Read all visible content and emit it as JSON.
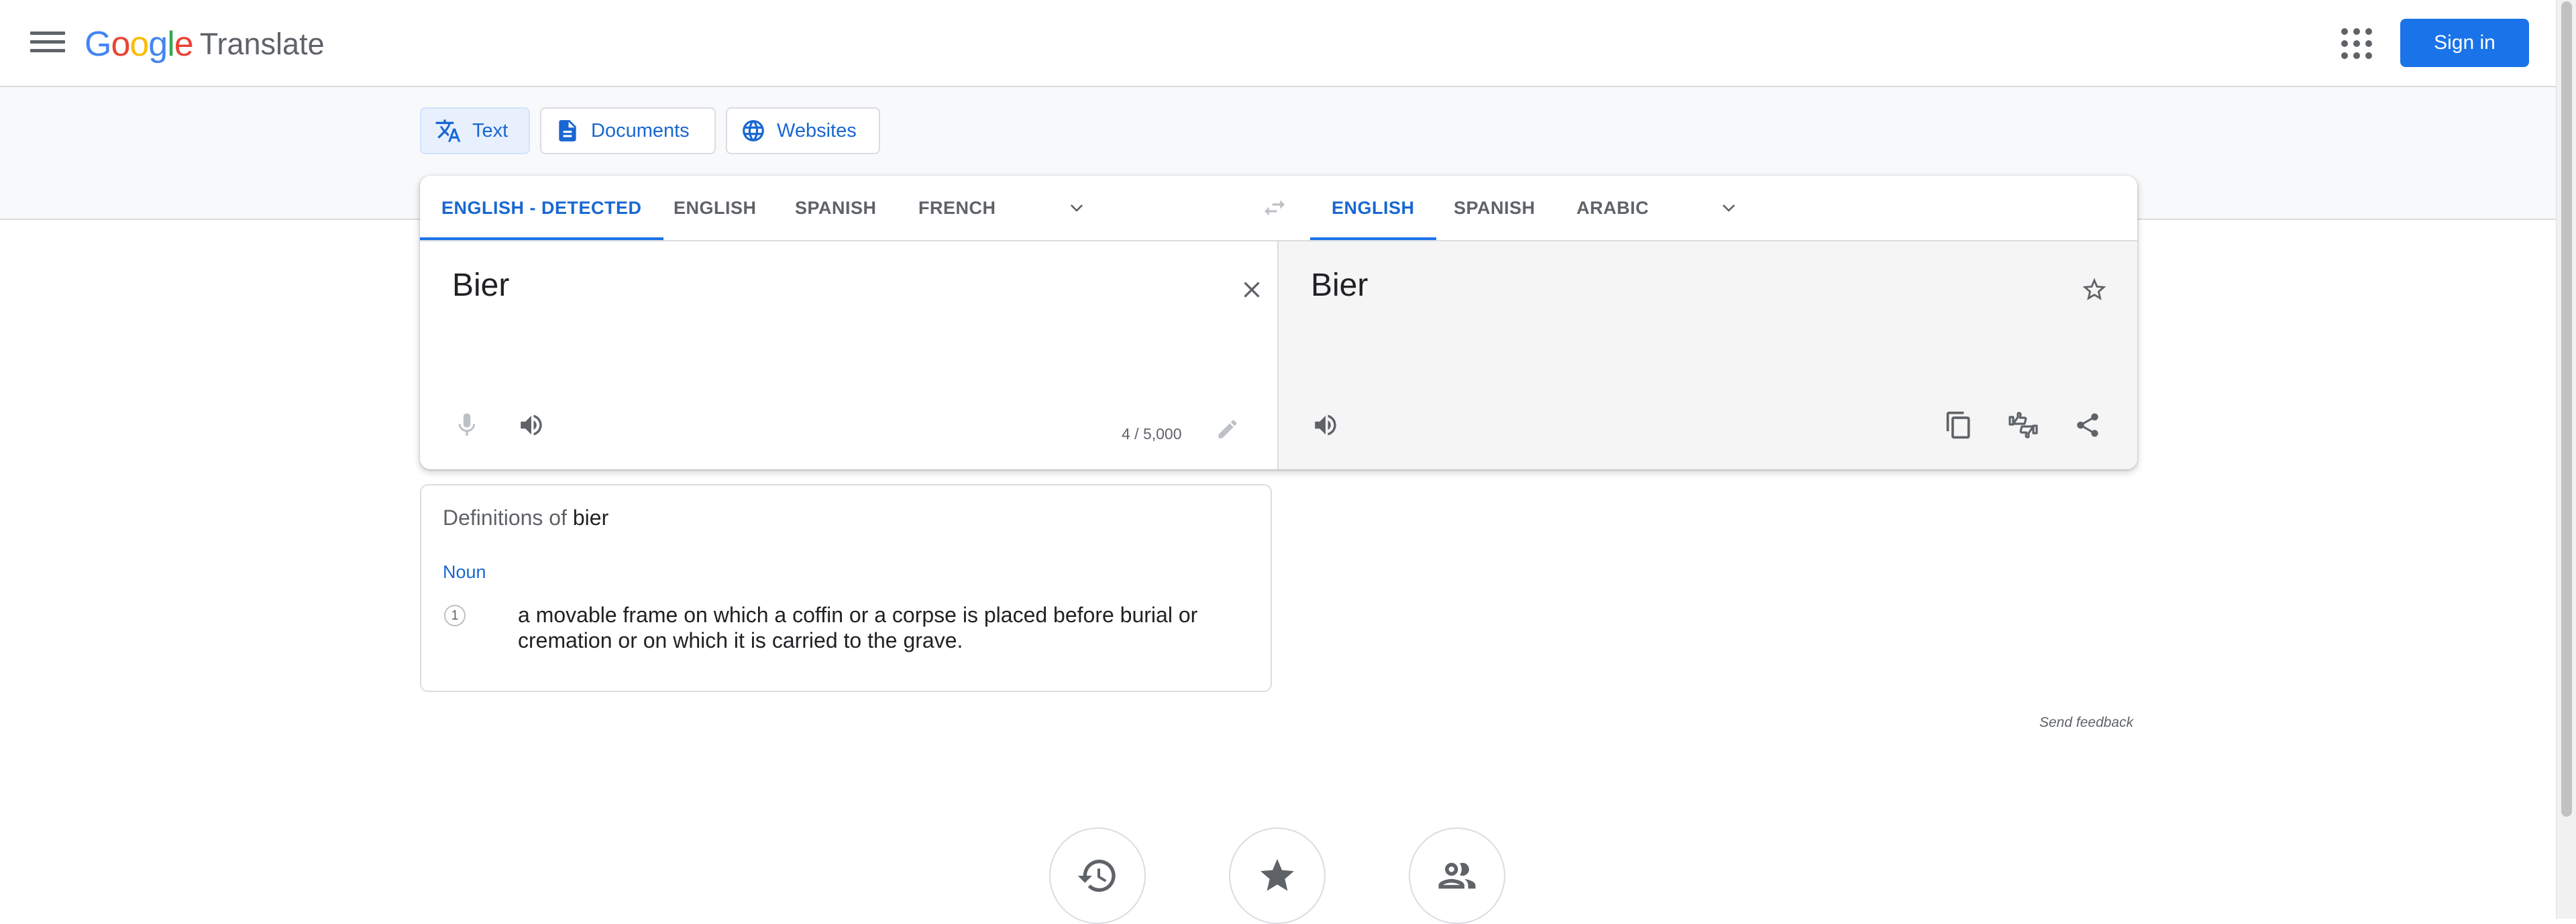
{
  "header": {
    "logo_letters": [
      "G",
      "o",
      "o",
      "g",
      "l",
      "e"
    ],
    "logo_colors": [
      "#4285F4",
      "#EA4335",
      "#FBBC05",
      "#4285F4",
      "#34A853",
      "#EA4335"
    ],
    "product": "Translate",
    "signin_label": "Sign in"
  },
  "modes": [
    {
      "label": "Text",
      "icon": "translate-icon",
      "active": true
    },
    {
      "label": "Documents",
      "icon": "document-icon",
      "active": false
    },
    {
      "label": "Websites",
      "icon": "globe-icon",
      "active": false
    }
  ],
  "source_langs": [
    "ENGLISH - DETECTED",
    "ENGLISH",
    "SPANISH",
    "FRENCH"
  ],
  "target_langs": [
    "ENGLISH",
    "SPANISH",
    "ARABIC"
  ],
  "source": {
    "text": "Bier",
    "counter": "4 / 5,000"
  },
  "target": {
    "text": "Bier"
  },
  "definitions": {
    "title_prefix": "Definitions of",
    "word": "bier",
    "part_of_speech": "Noun",
    "items": [
      {
        "number": "1",
        "text": "a movable frame on which a coffin or a corpse is placed before burial or cremation or on which it is carried to the grave."
      }
    ]
  },
  "feedback_label": "Send feedback",
  "colors": {
    "accent": "#1a73e8",
    "accent_text": "#1967d2",
    "icon": "#5f6368"
  }
}
